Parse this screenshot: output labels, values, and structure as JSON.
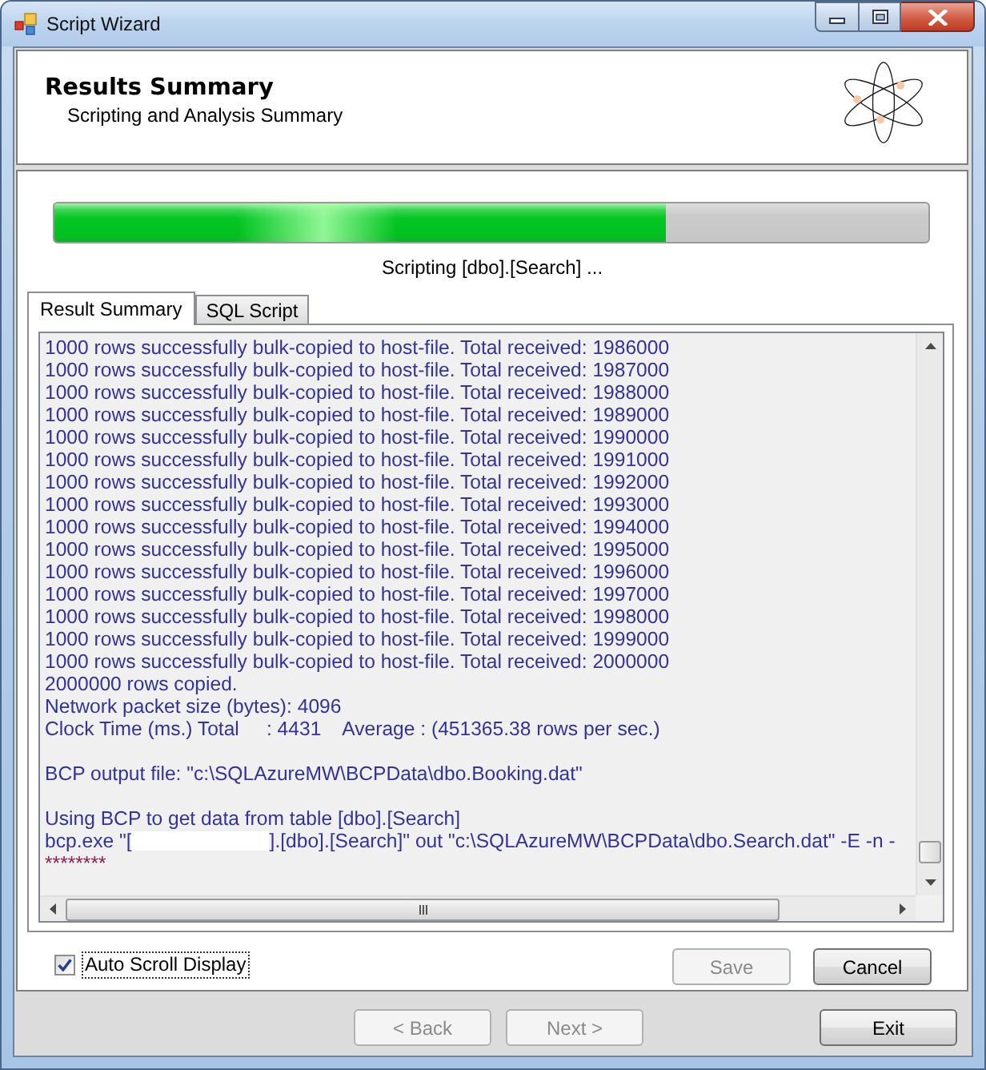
{
  "window": {
    "title": "Script Wizard"
  },
  "header": {
    "title": "Results Summary",
    "subtitle": "Scripting and Analysis Summary"
  },
  "progress": {
    "level": 0.7,
    "status": "Scripting [dbo].[Search] ..."
  },
  "tabs": [
    {
      "label": "Result Summary",
      "selected": true
    },
    {
      "label": "SQL Script",
      "selected": false
    }
  ],
  "log": [
    {
      "kind": "text",
      "text": "1000 rows successfully bulk-copied to host-file. Total received: 1986000"
    },
    {
      "kind": "text",
      "text": "1000 rows successfully bulk-copied to host-file. Total received: 1987000"
    },
    {
      "kind": "text",
      "text": "1000 rows successfully bulk-copied to host-file. Total received: 1988000"
    },
    {
      "kind": "text",
      "text": "1000 rows successfully bulk-copied to host-file. Total received: 1989000"
    },
    {
      "kind": "text",
      "text": "1000 rows successfully bulk-copied to host-file. Total received: 1990000"
    },
    {
      "kind": "text",
      "text": "1000 rows successfully bulk-copied to host-file. Total received: 1991000"
    },
    {
      "kind": "text",
      "text": "1000 rows successfully bulk-copied to host-file. Total received: 1992000"
    },
    {
      "kind": "text",
      "text": "1000 rows successfully bulk-copied to host-file. Total received: 1993000"
    },
    {
      "kind": "text",
      "text": "1000 rows successfully bulk-copied to host-file. Total received: 1994000"
    },
    {
      "kind": "text",
      "text": "1000 rows successfully bulk-copied to host-file. Total received: 1995000"
    },
    {
      "kind": "text",
      "text": "1000 rows successfully bulk-copied to host-file. Total received: 1996000"
    },
    {
      "kind": "text",
      "text": "1000 rows successfully bulk-copied to host-file. Total received: 1997000"
    },
    {
      "kind": "text",
      "text": "1000 rows successfully bulk-copied to host-file. Total received: 1998000"
    },
    {
      "kind": "text",
      "text": "1000 rows successfully bulk-copied to host-file. Total received: 1999000"
    },
    {
      "kind": "text",
      "text": "1000 rows successfully bulk-copied to host-file. Total received: 2000000"
    },
    {
      "kind": "text",
      "text": "2000000 rows copied."
    },
    {
      "kind": "text",
      "text": "Network packet size (bytes): 4096"
    },
    {
      "kind": "text",
      "text": "Clock Time (ms.) Total     : 4431    Average : (451365.38 rows per sec.)"
    },
    {
      "kind": "blank"
    },
    {
      "kind": "text",
      "text": "BCP output file: \"c:\\SQLAzureMW\\BCPData\\dbo.Booking.dat\""
    },
    {
      "kind": "blank"
    },
    {
      "kind": "text",
      "text": "Using BCP to get data from table [dbo].[Search]"
    },
    {
      "kind": "redacted",
      "before": "bcp.exe \"[",
      "after": "].[dbo].[Search]\" out \"c:\\SQLAzureMW\\BCPData\\dbo.Search.dat\" -E -n -"
    },
    {
      "kind": "marker",
      "text": "********"
    }
  ],
  "auto_scroll": {
    "label": "Auto Scroll Display",
    "checked": true,
    "focused": true
  },
  "panel_buttons": [
    {
      "label": "Save",
      "disabled": true
    },
    {
      "label": "Cancel",
      "disabled": false
    }
  ],
  "nav_buttons": [
    {
      "label": "< Back",
      "disabled": true
    },
    {
      "label": "Next >",
      "disabled": true
    }
  ],
  "exit_button": {
    "label": "Exit",
    "disabled": false
  }
}
